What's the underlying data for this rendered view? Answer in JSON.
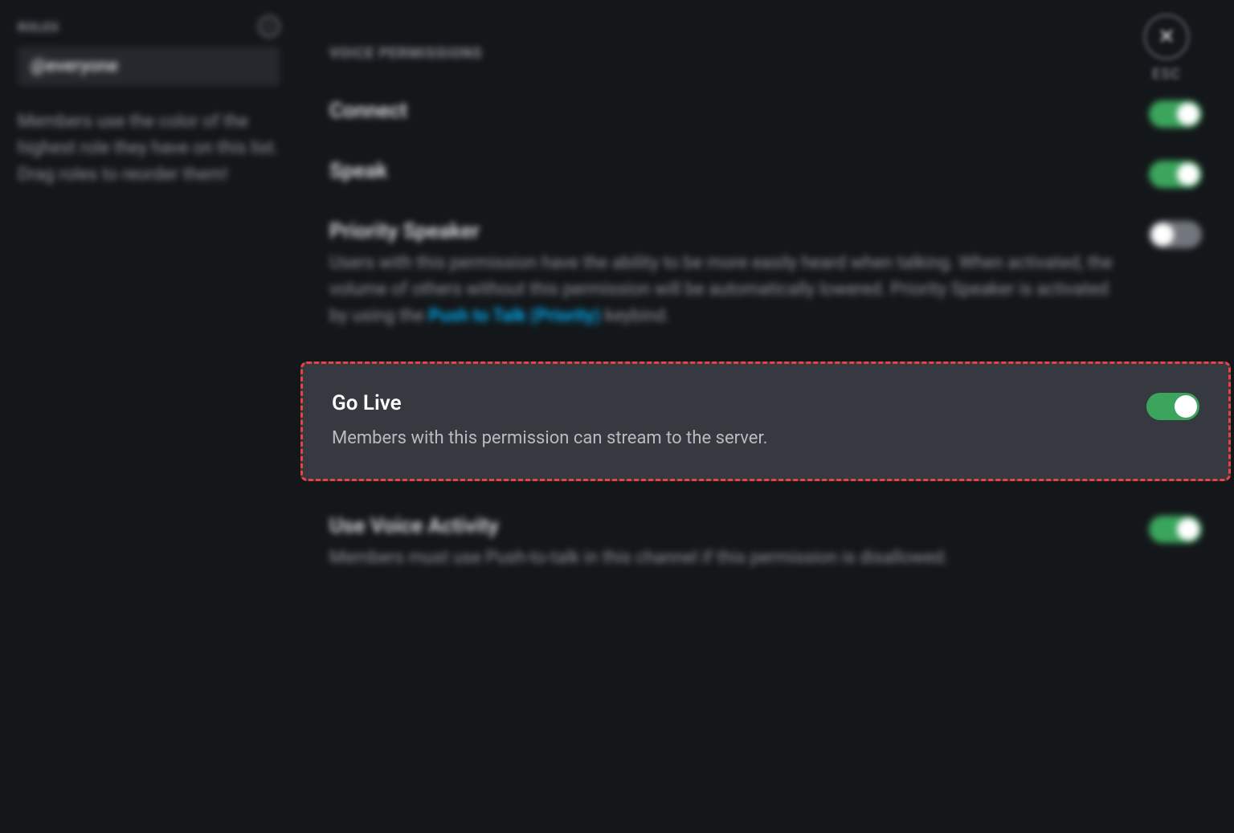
{
  "sidebar": {
    "roles_label": "ROLES",
    "role_item": "@everyone",
    "hint": "Members use the color of the highest role they have on this list. Drag roles to reorder them!"
  },
  "close": {
    "esc_label": "ESC"
  },
  "main": {
    "section_heading": "VOICE PERMISSIONS",
    "permissions": {
      "connect": {
        "title": "Connect",
        "enabled": true
      },
      "speak": {
        "title": "Speak",
        "enabled": true
      },
      "priority_speaker": {
        "title": "Priority Speaker",
        "desc_pre": "Users with this permission have the ability to be more easily heard when talking. When activated, the volume of others without this permission will be automatically lowered. Priority Speaker is activated by using the ",
        "link": "Push to Talk (Priority)",
        "desc_post": " keybind.",
        "enabled": false
      },
      "go_live": {
        "title": "Go Live",
        "desc": "Members with this permission can stream to the server.",
        "enabled": true
      },
      "use_voice_activity": {
        "title": "Use Voice Activity",
        "desc": "Members must use Push-to-talk in this channel if this permission is disallowed.",
        "enabled": true
      }
    }
  }
}
